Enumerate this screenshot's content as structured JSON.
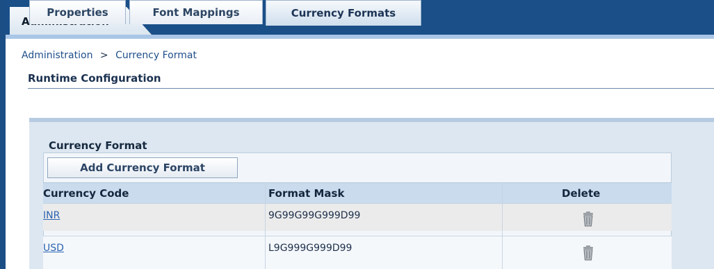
{
  "top_tab": {
    "label": "Administration"
  },
  "breadcrumb": {
    "root": "Administration",
    "separator": ">",
    "current": "Currency Format"
  },
  "subtitle": "Runtime Configuration",
  "tabs": [
    {
      "label": "Properties",
      "active": false
    },
    {
      "label": "Font Mappings",
      "active": false
    },
    {
      "label": "Currency Formats",
      "active": true
    }
  ],
  "section": {
    "title": "Currency Format",
    "add_button": "Add Currency Format"
  },
  "table": {
    "columns": [
      "Currency Code",
      "Format Mask",
      "Delete"
    ],
    "rows": [
      {
        "code": "INR",
        "mask": "9G99G99G999D99",
        "delete_icon": "trash-icon"
      },
      {
        "code": "USD",
        "mask": "L9G999G999D99",
        "delete_icon": "trash-icon"
      }
    ]
  },
  "colors": {
    "header_blue": "#1a4f88",
    "link": "#2b64b1",
    "panel": "#dde7f1"
  }
}
